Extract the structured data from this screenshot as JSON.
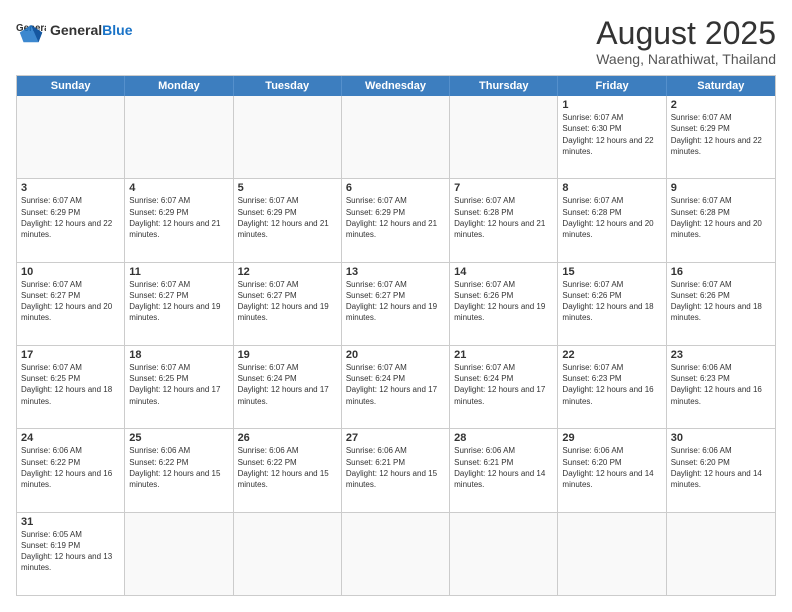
{
  "header": {
    "logo_general": "General",
    "logo_blue": "Blue",
    "month_title": "August 2025",
    "location": "Waeng, Narathiwat, Thailand"
  },
  "weekdays": [
    "Sunday",
    "Monday",
    "Tuesday",
    "Wednesday",
    "Thursday",
    "Friday",
    "Saturday"
  ],
  "weeks": [
    [
      {
        "day": "",
        "info": ""
      },
      {
        "day": "",
        "info": ""
      },
      {
        "day": "",
        "info": ""
      },
      {
        "day": "",
        "info": ""
      },
      {
        "day": "",
        "info": ""
      },
      {
        "day": "1",
        "info": "Sunrise: 6:07 AM\nSunset: 6:30 PM\nDaylight: 12 hours and 22 minutes."
      },
      {
        "day": "2",
        "info": "Sunrise: 6:07 AM\nSunset: 6:29 PM\nDaylight: 12 hours and 22 minutes."
      }
    ],
    [
      {
        "day": "3",
        "info": "Sunrise: 6:07 AM\nSunset: 6:29 PM\nDaylight: 12 hours and 22 minutes."
      },
      {
        "day": "4",
        "info": "Sunrise: 6:07 AM\nSunset: 6:29 PM\nDaylight: 12 hours and 21 minutes."
      },
      {
        "day": "5",
        "info": "Sunrise: 6:07 AM\nSunset: 6:29 PM\nDaylight: 12 hours and 21 minutes."
      },
      {
        "day": "6",
        "info": "Sunrise: 6:07 AM\nSunset: 6:29 PM\nDaylight: 12 hours and 21 minutes."
      },
      {
        "day": "7",
        "info": "Sunrise: 6:07 AM\nSunset: 6:28 PM\nDaylight: 12 hours and 21 minutes."
      },
      {
        "day": "8",
        "info": "Sunrise: 6:07 AM\nSunset: 6:28 PM\nDaylight: 12 hours and 20 minutes."
      },
      {
        "day": "9",
        "info": "Sunrise: 6:07 AM\nSunset: 6:28 PM\nDaylight: 12 hours and 20 minutes."
      }
    ],
    [
      {
        "day": "10",
        "info": "Sunrise: 6:07 AM\nSunset: 6:27 PM\nDaylight: 12 hours and 20 minutes."
      },
      {
        "day": "11",
        "info": "Sunrise: 6:07 AM\nSunset: 6:27 PM\nDaylight: 12 hours and 19 minutes."
      },
      {
        "day": "12",
        "info": "Sunrise: 6:07 AM\nSunset: 6:27 PM\nDaylight: 12 hours and 19 minutes."
      },
      {
        "day": "13",
        "info": "Sunrise: 6:07 AM\nSunset: 6:27 PM\nDaylight: 12 hours and 19 minutes."
      },
      {
        "day": "14",
        "info": "Sunrise: 6:07 AM\nSunset: 6:26 PM\nDaylight: 12 hours and 19 minutes."
      },
      {
        "day": "15",
        "info": "Sunrise: 6:07 AM\nSunset: 6:26 PM\nDaylight: 12 hours and 18 minutes."
      },
      {
        "day": "16",
        "info": "Sunrise: 6:07 AM\nSunset: 6:26 PM\nDaylight: 12 hours and 18 minutes."
      }
    ],
    [
      {
        "day": "17",
        "info": "Sunrise: 6:07 AM\nSunset: 6:25 PM\nDaylight: 12 hours and 18 minutes."
      },
      {
        "day": "18",
        "info": "Sunrise: 6:07 AM\nSunset: 6:25 PM\nDaylight: 12 hours and 17 minutes."
      },
      {
        "day": "19",
        "info": "Sunrise: 6:07 AM\nSunset: 6:24 PM\nDaylight: 12 hours and 17 minutes."
      },
      {
        "day": "20",
        "info": "Sunrise: 6:07 AM\nSunset: 6:24 PM\nDaylight: 12 hours and 17 minutes."
      },
      {
        "day": "21",
        "info": "Sunrise: 6:07 AM\nSunset: 6:24 PM\nDaylight: 12 hours and 17 minutes."
      },
      {
        "day": "22",
        "info": "Sunrise: 6:07 AM\nSunset: 6:23 PM\nDaylight: 12 hours and 16 minutes."
      },
      {
        "day": "23",
        "info": "Sunrise: 6:06 AM\nSunset: 6:23 PM\nDaylight: 12 hours and 16 minutes."
      }
    ],
    [
      {
        "day": "24",
        "info": "Sunrise: 6:06 AM\nSunset: 6:22 PM\nDaylight: 12 hours and 16 minutes."
      },
      {
        "day": "25",
        "info": "Sunrise: 6:06 AM\nSunset: 6:22 PM\nDaylight: 12 hours and 15 minutes."
      },
      {
        "day": "26",
        "info": "Sunrise: 6:06 AM\nSunset: 6:22 PM\nDaylight: 12 hours and 15 minutes."
      },
      {
        "day": "27",
        "info": "Sunrise: 6:06 AM\nSunset: 6:21 PM\nDaylight: 12 hours and 15 minutes."
      },
      {
        "day": "28",
        "info": "Sunrise: 6:06 AM\nSunset: 6:21 PM\nDaylight: 12 hours and 14 minutes."
      },
      {
        "day": "29",
        "info": "Sunrise: 6:06 AM\nSunset: 6:20 PM\nDaylight: 12 hours and 14 minutes."
      },
      {
        "day": "30",
        "info": "Sunrise: 6:06 AM\nSunset: 6:20 PM\nDaylight: 12 hours and 14 minutes."
      }
    ],
    [
      {
        "day": "31",
        "info": "Sunrise: 6:05 AM\nSunset: 6:19 PM\nDaylight: 12 hours and 13 minutes."
      },
      {
        "day": "",
        "info": ""
      },
      {
        "day": "",
        "info": ""
      },
      {
        "day": "",
        "info": ""
      },
      {
        "day": "",
        "info": ""
      },
      {
        "day": "",
        "info": ""
      },
      {
        "day": "",
        "info": ""
      }
    ]
  ]
}
